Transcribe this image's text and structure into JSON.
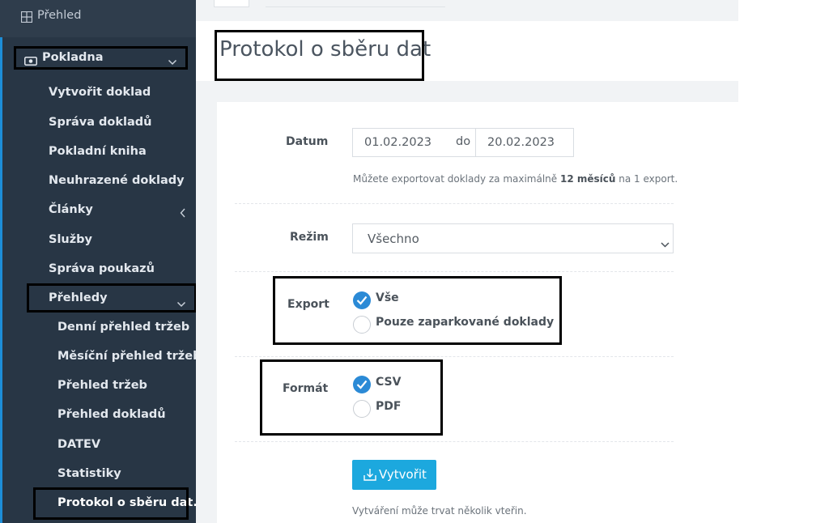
{
  "sidebar": {
    "overview_label": "Přehled",
    "section_label": "Pokladna",
    "items": [
      "Vytvořit doklad",
      "Správa dokladů",
      "Pokladní kniha",
      "Neuhrazené doklady",
      "Články",
      "Služby",
      "Správa poukazů",
      "Přehledy"
    ],
    "subitems": [
      "Denní přehled tržeb",
      "Měsíční přehled tržeb",
      "Přehled tržeb",
      "Přehled dokladů",
      "DATEV",
      "Statistiky",
      "Protokol o sběru dat."
    ]
  },
  "page": {
    "title": "Protokol o sběru dat"
  },
  "form": {
    "date_label": "Datum",
    "date_from": "01.02.2023",
    "date_sep": "do",
    "date_to": "20.02.2023",
    "date_help_before": "Můžete exportovat doklady za maximálně ",
    "date_help_bold": "12 měsíců",
    "date_help_after": " na 1 export.",
    "mode_label": "Režim",
    "mode_value": "Všechno",
    "export_label": "Export",
    "export_options": [
      "Vše",
      "Pouze zaparkované doklady"
    ],
    "export_selected": "Vše",
    "format_label": "Formát",
    "format_options": [
      "CSV",
      "PDF"
    ],
    "format_selected": "CSV",
    "create_button": "Vytvořit",
    "create_help": "Vytváření může trvat několik vteřin."
  },
  "colors": {
    "sidebar_bg": "#2f3d4c",
    "accent": "#1d8ed8",
    "button": "#1ca8de",
    "radio_checked": "#2b8ad6"
  }
}
